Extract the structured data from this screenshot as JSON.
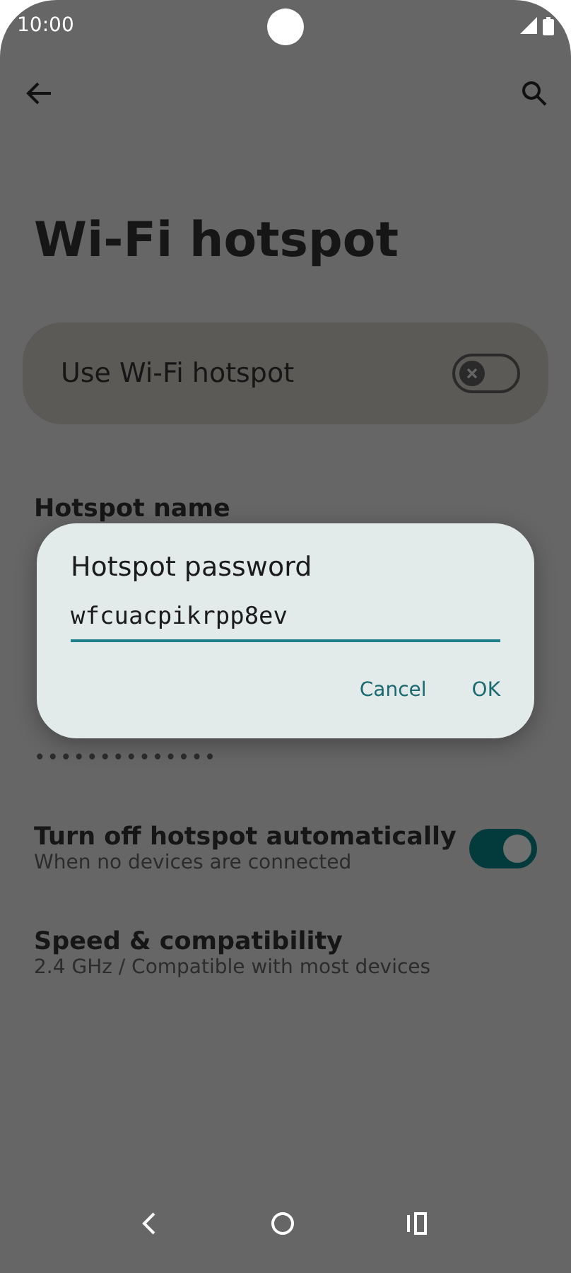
{
  "status_bar": {
    "time": "10:00"
  },
  "title": "Wi-Fi hotspot",
  "main_toggle": {
    "label": "Use Wi-Fi hotspot",
    "on": false
  },
  "settings": [
    {
      "kind": "text",
      "title": "Hotspot name"
    },
    {
      "kind": "text",
      "value": "••••••••••••••"
    },
    {
      "kind": "switch",
      "title": "Turn off hotspot automatically",
      "subtitle": "When no devices are connected",
      "on": true
    },
    {
      "kind": "text",
      "title": "Speed & compatibility",
      "subtitle": "2.4 GHz / Compatible with most devices"
    }
  ],
  "dialog": {
    "title": "Hotspot password",
    "value": "wfcuacpikrpp8ev",
    "buttons": [
      "Cancel",
      "OK"
    ]
  }
}
